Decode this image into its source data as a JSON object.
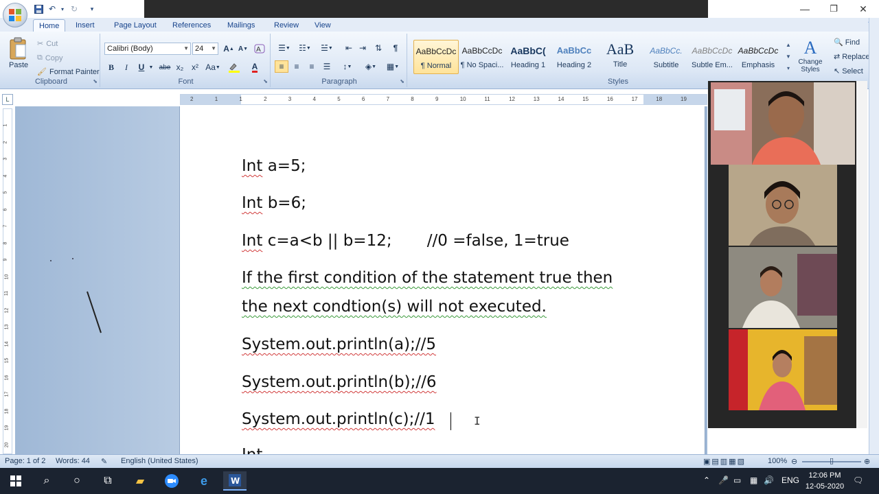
{
  "quick_access": {
    "save_icon": "save-icon",
    "undo_icon": "undo-icon",
    "redo_icon": "redo-icon",
    "customize_icon": "chevron-down-icon"
  },
  "window_controls": {
    "minimize": "—",
    "maximize": "❐",
    "close": "✕"
  },
  "ribbon_tabs": [
    "Home",
    "Insert",
    "Page Layout",
    "References",
    "Mailings",
    "Review",
    "View"
  ],
  "clipboard": {
    "paste": "Paste",
    "cut": "Cut",
    "copy": "Copy",
    "format_painter": "Format Painter",
    "label": "Clipboard"
  },
  "font": {
    "name": "Calibri (Body)",
    "size": "24",
    "label": "Font",
    "bold": "B",
    "italic": "I",
    "underline": "U",
    "strike": "abe",
    "subscript": "x₂",
    "superscript": "x²",
    "change_case": "Aa",
    "font_color": "A"
  },
  "paragraph": {
    "label": "Paragraph",
    "pilcrow": "¶"
  },
  "styles": {
    "label": "Styles",
    "items": [
      {
        "sample": "AaBbCcDc",
        "name": "¶ Normal"
      },
      {
        "sample": "AaBbCcDc",
        "name": "¶ No Spaci..."
      },
      {
        "sample": "AaBbC(",
        "name": "Heading 1"
      },
      {
        "sample": "AaBbCc",
        "name": "Heading 2"
      },
      {
        "sample": "AaB",
        "name": "Title"
      },
      {
        "sample": "AaBbCc.",
        "name": "Subtitle"
      },
      {
        "sample": "AaBbCcDc",
        "name": "Subtle Em..."
      },
      {
        "sample": "AaBbCcDc",
        "name": "Emphasis"
      }
    ],
    "change_styles": "Change Styles"
  },
  "editing": {
    "find": "Find",
    "replace": "Replace",
    "select": "Select"
  },
  "ruler_numbers": [
    "2",
    "1",
    "1",
    "2",
    "3",
    "4",
    "5",
    "6",
    "7",
    "8",
    "9",
    "10",
    "11",
    "12",
    "13",
    "14",
    "15",
    "16",
    "17",
    "18",
    "19"
  ],
  "vruler_numbers": [
    "1",
    "2",
    "3",
    "4",
    "5",
    "6",
    "7",
    "8",
    "9",
    "10",
    "11",
    "12",
    "13",
    "14",
    "15",
    "16",
    "17",
    "18",
    "19",
    "20"
  ],
  "document": {
    "line1_a": "Int",
    "line1_b": " a=5;",
    "line2_a": "Int",
    "line2_b": " b=6;",
    "line3_a": "Int",
    "line3_b": " c=a<b || b=12;       //0 =false, 1=true",
    "line4": "If the first condition of the statement true then",
    "line5": "the next condtion(s) will not executed.",
    "line6": "System.out.println(a);//5",
    "line7": "System.out.println(b);//6",
    "line8": "System.out.println(c);//1",
    "line9": "Int"
  },
  "status": {
    "page": "Page: 1 of 2",
    "words": "Words: 44",
    "language": "English (United States)",
    "zoom": "100%"
  },
  "taskbar": {
    "time": "12:06 PM",
    "date": "12-05-2020",
    "lang": "ENG"
  }
}
